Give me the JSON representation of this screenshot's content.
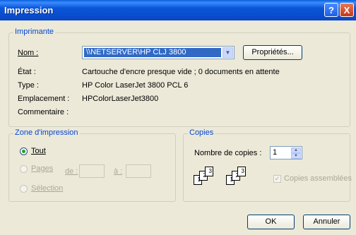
{
  "window": {
    "title": "Impression",
    "help_label": "?",
    "close_label": "X"
  },
  "printer": {
    "legend": "Imprimante",
    "name_label": "Nom :",
    "name_value": "\\\\NETSERVER\\HP CLJ 3800",
    "properties_button": "Propriétés...",
    "state_label": "État :",
    "state_value": "Cartouche d'encre presque vide ; 0 documents en attente",
    "type_label": "Type :",
    "type_value": "HP Color LaserJet 3800 PCL 6",
    "location_label": "Emplacement :",
    "location_value": "HPColorLaserJet3800",
    "comment_label": "Commentaire :"
  },
  "range": {
    "legend": "Zone d'impression",
    "all_label": "Tout",
    "pages_label": "Pages",
    "from_label": "de :",
    "to_label": "à :",
    "selection_label": "Sélection"
  },
  "copies": {
    "legend": "Copies",
    "count_label": "Nombre de copies :",
    "count_value": "1",
    "collate_label": "Copies assemblées",
    "page_numbers": [
      "1",
      "2",
      "3"
    ]
  },
  "buttons": {
    "ok": "OK",
    "cancel": "Annuler"
  }
}
